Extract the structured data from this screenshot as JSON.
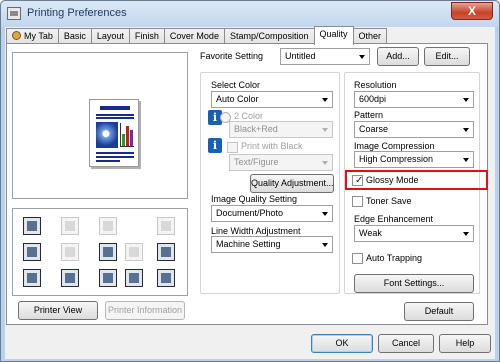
{
  "window": {
    "title": "Printing Preferences",
    "close_label": "X"
  },
  "tabs": [
    {
      "label": "My Tab"
    },
    {
      "label": "Basic"
    },
    {
      "label": "Layout"
    },
    {
      "label": "Finish"
    },
    {
      "label": "Cover Mode"
    },
    {
      "label": "Stamp/Composition"
    },
    {
      "label": "Quality"
    },
    {
      "label": "Other"
    }
  ],
  "favorite": {
    "label": "Favorite Setting",
    "value": "Untitled",
    "add_label": "Add...",
    "edit_label": "Edit..."
  },
  "preview": {
    "printer_view_label": "Printer View",
    "printer_info_label": "Printer Information"
  },
  "color": {
    "select_label": "Select Color",
    "select_value": "Auto Color",
    "two_color_label": "2 Color",
    "two_color_value": "Black+Red",
    "print_black_label": "Print with Black",
    "print_black_value": "Text/Figure",
    "quality_adjustment_label": "Quality Adjustment..."
  },
  "image_quality": {
    "label": "Image Quality Setting",
    "value": "Document/Photo"
  },
  "line_width": {
    "label": "Line Width Adjustment",
    "value": "Machine Setting"
  },
  "resolution": {
    "label": "Resolution",
    "value": "600dpi"
  },
  "pattern": {
    "label": "Pattern",
    "value": "Coarse"
  },
  "compression": {
    "label": "Image Compression",
    "value": "High Compression"
  },
  "glossy": {
    "label": "Glossy Mode",
    "checked": true
  },
  "toner_save": {
    "label": "Toner Save",
    "checked": false
  },
  "edge": {
    "label": "Edge Enhancement",
    "value": "Weak"
  },
  "auto_trapping": {
    "label": "Auto Trapping",
    "checked": false
  },
  "font_settings_label": "Font Settings...",
  "default_label": "Default",
  "footer": {
    "ok_label": "OK",
    "cancel_label": "Cancel",
    "help_label": "Help"
  },
  "colors": {
    "highlight": "#e0101b",
    "titlebar": "#c2d6ee",
    "info_icon": "#1a5fb4"
  }
}
